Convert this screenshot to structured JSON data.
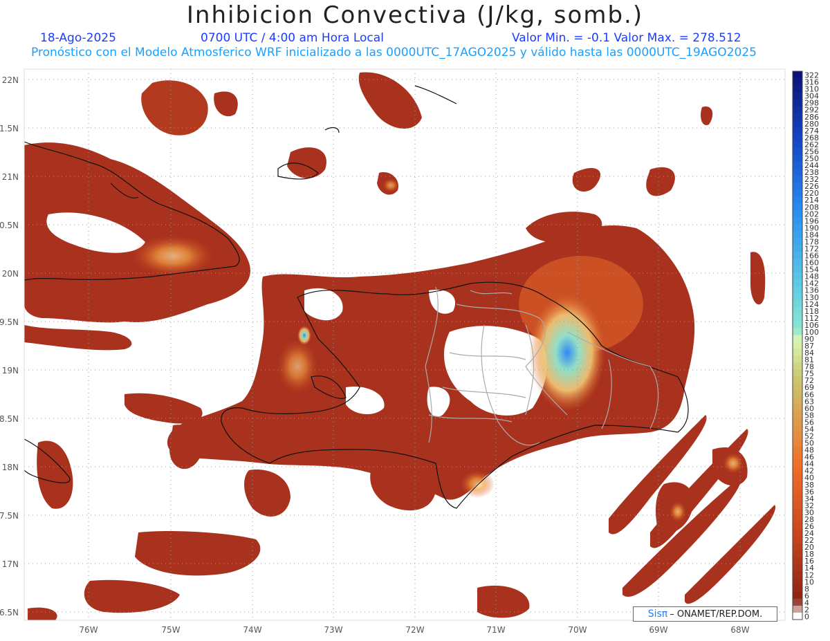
{
  "header": {
    "title": "Inhibicion Convectiva (J/kg, somb.)",
    "date": "18-Ago-2025",
    "time": "0700 UTC / 4:00 am Hora Local",
    "min_max": "Valor Min. = -0.1  Valor Max. = 278.512",
    "model_info": "Pronóstico con el Modelo Atmosferico WRF inicializado a las 0000UTC_17AGO2025 y válido hasta las  0000UTC_19AGO2025"
  },
  "axes": {
    "lat_labels": [
      "22N",
      "1.5N",
      "21N",
      "0.5N",
      "20N",
      "9.5N",
      "19N",
      "8.5N",
      "18N",
      "7.5N",
      "17N",
      "6.5N"
    ],
    "lon_labels": [
      "76W",
      "75W",
      "74W",
      "73W",
      "72W",
      "71W",
      "70W",
      "69W",
      "68W"
    ]
  },
  "colorbar": {
    "labels": [
      "322",
      "316",
      "310",
      "304",
      "298",
      "292",
      "286",
      "280",
      "274",
      "268",
      "262",
      "256",
      "250",
      "244",
      "238",
      "232",
      "226",
      "220",
      "214",
      "208",
      "202",
      "196",
      "190",
      "184",
      "178",
      "172",
      "166",
      "160",
      "154",
      "148",
      "142",
      "136",
      "130",
      "124",
      "118",
      "112",
      "106",
      "100",
      "90",
      "87",
      "84",
      "81",
      "78",
      "75",
      "72",
      "69",
      "66",
      "63",
      "60",
      "58",
      "56",
      "54",
      "52",
      "50",
      "48",
      "46",
      "44",
      "42",
      "40",
      "38",
      "36",
      "34",
      "32",
      "30",
      "28",
      "26",
      "24",
      "22",
      "20",
      "18",
      "16",
      "14",
      "12",
      "10",
      "8",
      "6",
      "4",
      "2",
      "0"
    ]
  },
  "credit": {
    "prefix": "Sis",
    "pi": "π",
    "text": "– ONAMET/REP.DOM."
  },
  "colors": {
    "field_dark": "#a8321d",
    "field_mid": "#c8421e",
    "field_bright": "#f07a2a",
    "high": "#9fe8c8",
    "max": "#2a8cff",
    "coast": "#111111",
    "border": "#aaaaaa"
  }
}
